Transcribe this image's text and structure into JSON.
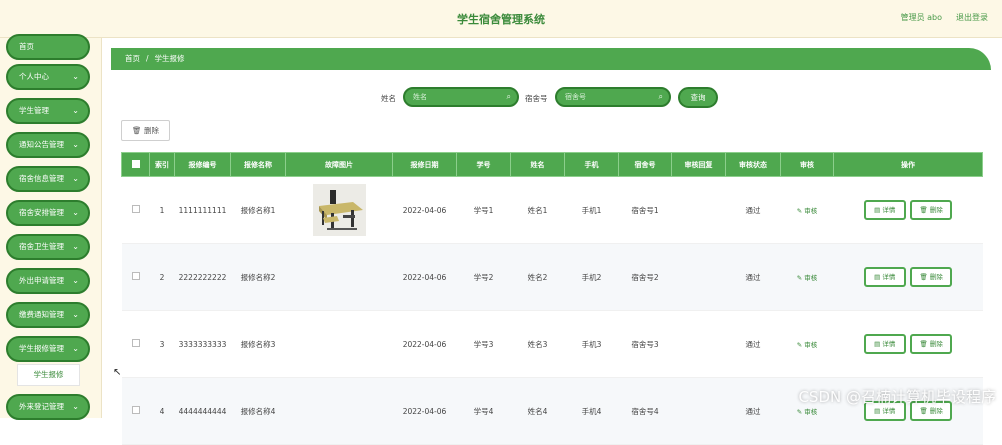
{
  "header": {
    "title": "学生宿舍管理系统",
    "admin": "管理员 abo",
    "logout": "退出登录"
  },
  "sidebar": {
    "items": [
      {
        "label": "首页",
        "chevron": false
      },
      {
        "label": "个人中心",
        "chevron": true
      },
      {
        "label": "学生管理",
        "chevron": true
      },
      {
        "label": "通知公告管理",
        "chevron": true
      },
      {
        "label": "宿舍信息管理",
        "chevron": true
      },
      {
        "label": "宿舍安排管理",
        "chevron": true
      },
      {
        "label": "宿舍卫生管理",
        "chevron": true
      },
      {
        "label": "外出申请管理",
        "chevron": true
      },
      {
        "label": "缴费通知管理",
        "chevron": true
      },
      {
        "label": "学生报修管理",
        "chevron": true
      },
      {
        "label": "外来登记管理",
        "chevron": true
      }
    ],
    "active_submenu": "学生报修",
    "chevron_glyph": "⌄"
  },
  "breadcrumb": {
    "home": "首页",
    "separator": "/",
    "current": "学生报修"
  },
  "search": {
    "name_label": "姓名",
    "name_placeholder": "姓名",
    "dorm_label": "宿舍号",
    "dorm_placeholder": "宿舍号",
    "query_button": "查询",
    "search_glyph": "⌕"
  },
  "toolbar": {
    "delete_label": "删除",
    "delete_glyph": "🗑"
  },
  "table": {
    "headers": [
      "",
      "索引",
      "报修编号",
      "报修名称",
      "故障图片",
      "报修日期",
      "学号",
      "姓名",
      "手机",
      "宿舍号",
      "审核回复",
      "审核状态",
      "审核",
      "操作"
    ],
    "rows": [
      {
        "index": "1",
        "number": "1111111111",
        "name": "报修名称1",
        "image": true,
        "date": "2022-04-06",
        "student_id": "学号1",
        "student_name": "姓名1",
        "phone": "手机1",
        "dorm": "宿舍号1",
        "reply": "",
        "status": "通过",
        "audit": "审核"
      },
      {
        "index": "2",
        "number": "2222222222",
        "name": "报修名称2",
        "image": false,
        "date": "2022-04-06",
        "student_id": "学号2",
        "student_name": "姓名2",
        "phone": "手机2",
        "dorm": "宿舍号2",
        "reply": "",
        "status": "通过",
        "audit": "审核"
      },
      {
        "index": "3",
        "number": "3333333333",
        "name": "报修名称3",
        "image": false,
        "date": "2022-04-06",
        "student_id": "学号3",
        "student_name": "姓名3",
        "phone": "手机3",
        "dorm": "宿舍号3",
        "reply": "",
        "status": "通过",
        "audit": "审核"
      },
      {
        "index": "4",
        "number": "4444444444",
        "name": "报修名称4",
        "image": false,
        "date": "2022-04-06",
        "student_id": "学号4",
        "student_name": "姓名4",
        "phone": "手机4",
        "dorm": "宿舍号4",
        "reply": "",
        "status": "通过",
        "audit": "审核"
      }
    ],
    "detail_label": "详情",
    "delete_label": "删除",
    "audit_glyph": "✎",
    "detail_glyph": "▤",
    "delete_glyph": "🗑"
  },
  "watermark": "CSDN @召楠计算机毕设程序",
  "colors": {
    "primary": "#4fa84f",
    "primary_dark": "#2d7d2d",
    "header_bg": "#fdf8e6"
  }
}
